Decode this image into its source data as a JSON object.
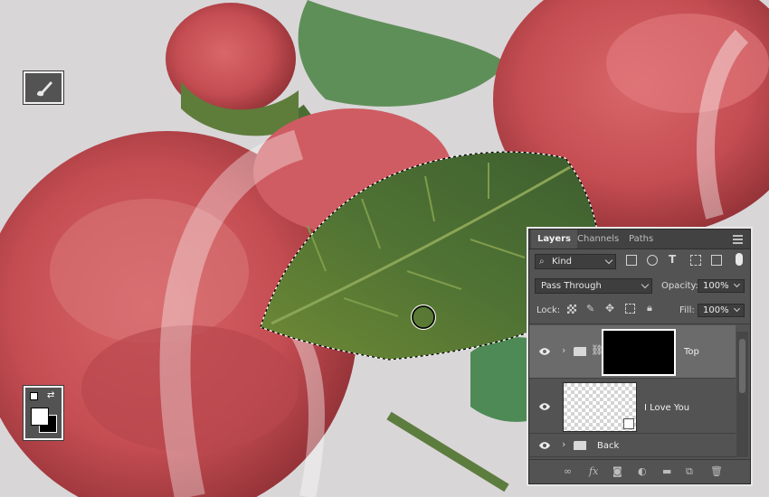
{
  "canvas": {
    "background": "#d9d6d8",
    "selection": "marching-ants"
  },
  "tools": {
    "brush": {
      "icon": "brush-icon"
    },
    "colors": {
      "foreground": "#ffffff",
      "background": "#000000",
      "icons": [
        "default-colors-icon",
        "swap-colors-icon"
      ]
    }
  },
  "layers_panel": {
    "tabs": [
      "Layers",
      "Channels",
      "Paths"
    ],
    "active_tab": "Layers",
    "filter": {
      "value": "Kind"
    },
    "blend_mode": "Pass Through",
    "opacity": {
      "label": "Opacity:",
      "value": "100%"
    },
    "lock": {
      "label": "Lock:"
    },
    "fill": {
      "label": "Fill:",
      "value": "100%"
    },
    "layers": [
      {
        "name": "Top",
        "type": "group",
        "selected": true
      },
      {
        "name": "I Love You",
        "type": "smart-object"
      },
      {
        "name": "Back",
        "type": "group"
      }
    ]
  }
}
